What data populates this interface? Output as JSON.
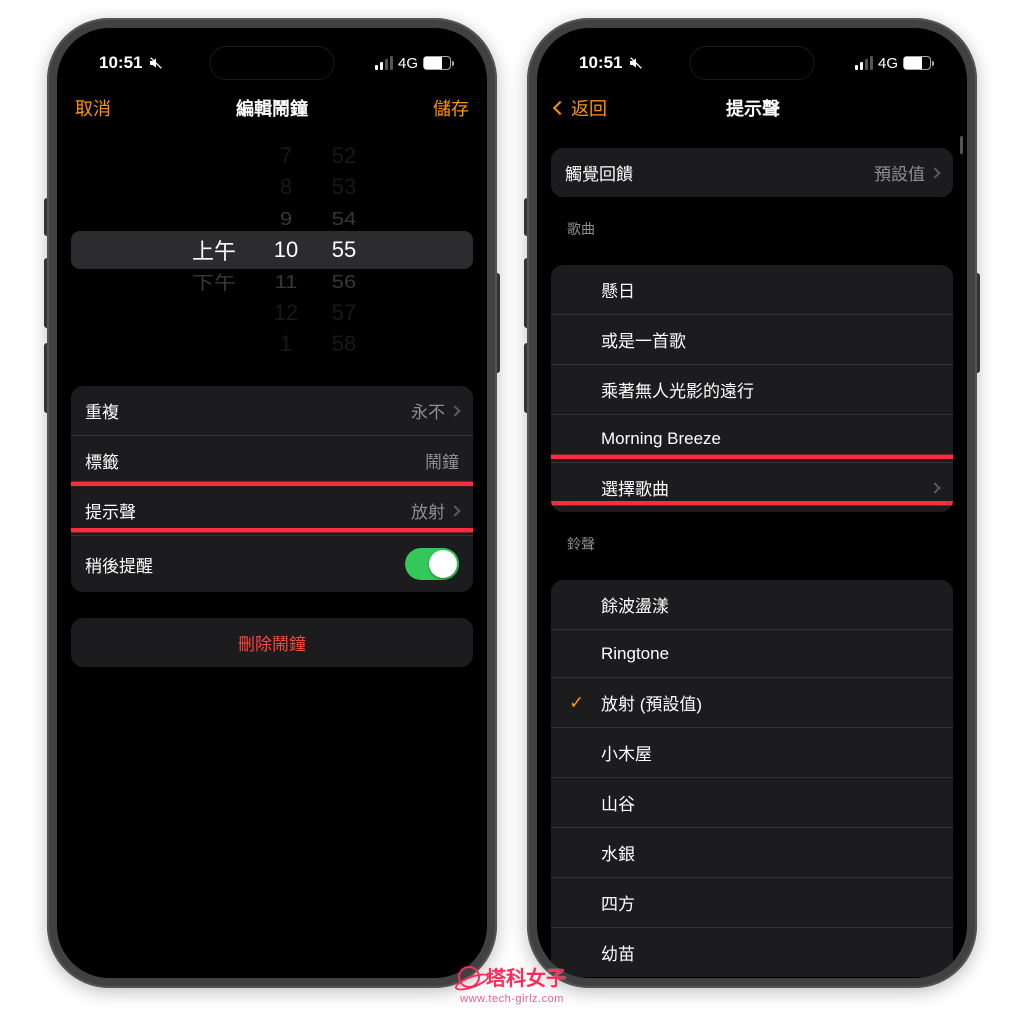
{
  "status": {
    "time": "10:51",
    "network": "4G"
  },
  "left_phone": {
    "nav": {
      "cancel": "取消",
      "title": "編輯鬧鐘",
      "save": "儲存"
    },
    "picker": {
      "ampm_sel": "上午",
      "ampm_next": "下午",
      "hour_rows": [
        "7",
        "8",
        "9",
        "10",
        "11",
        "12",
        "1"
      ],
      "min_rows": [
        "52",
        "53",
        "54",
        "55",
        "56",
        "57",
        "58"
      ]
    },
    "rows": {
      "repeat_label": "重複",
      "repeat_val": "永不",
      "label_label": "標籤",
      "label_val": "鬧鐘",
      "sound_label": "提示聲",
      "sound_val": "放射",
      "snooze_label": "稍後提醒"
    },
    "delete": "刪除鬧鐘"
  },
  "right_phone": {
    "nav": {
      "back": "返回",
      "title": "提示聲"
    },
    "haptic_label": "觸覺回饋",
    "haptic_val": "預設值",
    "songs_header": "歌曲",
    "songs": [
      "懸日",
      "或是一首歌",
      "乘著無人光影的遠行",
      "Morning Breeze"
    ],
    "pick_song": "選擇歌曲",
    "ringtones_header": "鈴聲",
    "ringtones": [
      "餘波盪漾",
      "Ringtone",
      "放射 (預設值)",
      "小木屋",
      "山谷",
      "水銀",
      "四方",
      "幼苗"
    ],
    "ringtone_selected_index": 2
  },
  "watermark": {
    "title": "塔科女子",
    "url": "www.tech-girlz.com"
  }
}
